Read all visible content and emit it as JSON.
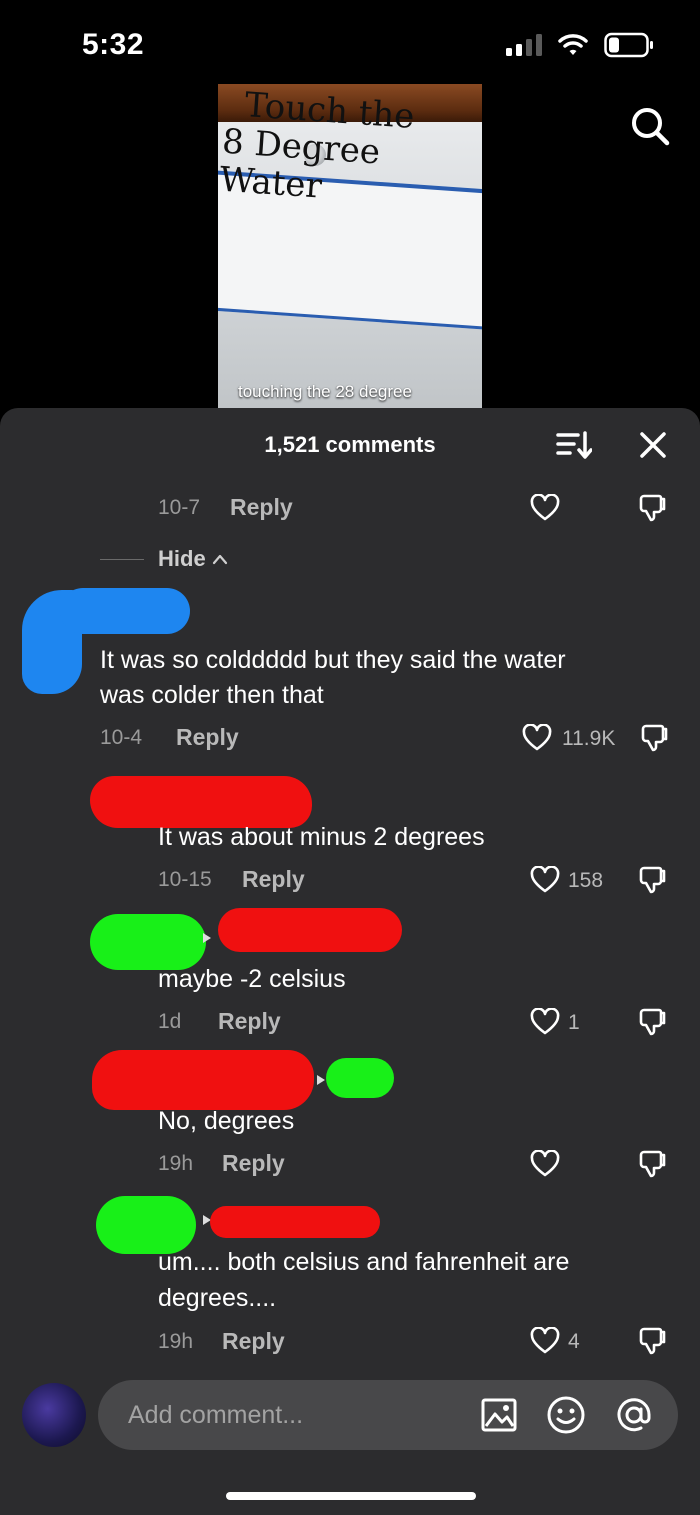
{
  "status_bar": {
    "time": "5:32"
  },
  "video": {
    "sign_line1": "Touch the",
    "sign_line2": "8 Degree Water",
    "caption": "touching the 28 degree"
  },
  "sheet": {
    "title": "1,521 comments"
  },
  "comments": [
    {
      "id": "c0",
      "date": "10-7",
      "reply": "Reply",
      "likes": ""
    },
    {
      "id": "c1",
      "text_line1": "It was so colddddd but they said the water",
      "text_line2": "was colder then that",
      "date": "10-4",
      "reply": "Reply",
      "likes": "11.9K"
    },
    {
      "id": "c2",
      "text": "It was about minus 2 degrees",
      "date": "10-15",
      "reply": "Reply",
      "likes": "158"
    },
    {
      "id": "c3",
      "text": "maybe -2 celsius",
      "date": "1d",
      "reply": "Reply",
      "likes": "1"
    },
    {
      "id": "c4",
      "text": "No, degrees",
      "date": "19h",
      "reply": "Reply",
      "likes": ""
    },
    {
      "id": "c5",
      "text_line1": "um.... both celsius and fahrenheit are",
      "text_line2": "degrees....",
      "date": "19h",
      "reply": "Reply",
      "likes": "4"
    }
  ],
  "hide_label": "Hide",
  "input": {
    "placeholder": "Add comment..."
  },
  "icons": {
    "search": "search-icon",
    "sort": "sort-icon",
    "close": "close-icon",
    "heart": "heart-icon",
    "dislike": "dislike-icon",
    "image": "image-icon",
    "emoji": "emoji-icon",
    "mention": "at-icon"
  },
  "colors": {
    "sheet_bg": "#2c2c2e",
    "input_bg": "#48484a"
  }
}
